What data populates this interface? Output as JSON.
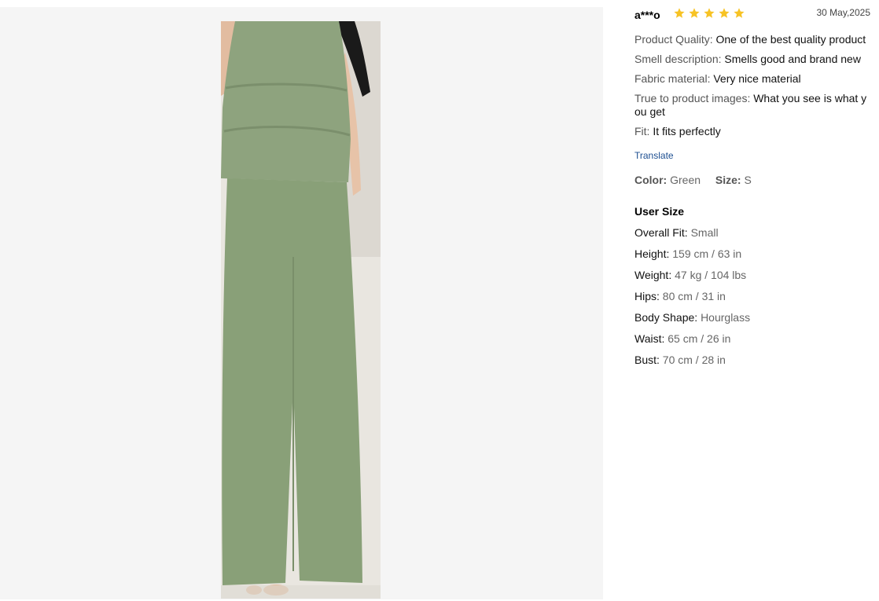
{
  "review": {
    "user": "a***o",
    "rating": 5,
    "date": "30 May,2025",
    "attributes": [
      {
        "key": "Product Quality:",
        "value": "One of the best quality product"
      },
      {
        "key": "Smell description:",
        "value": "Smells good and brand new"
      },
      {
        "key": "Fabric material:",
        "value": "Very nice material"
      },
      {
        "key": "True to product images:",
        "value": "What you see is what you get"
      },
      {
        "key": "Fit:",
        "value": "It fits perfectly"
      }
    ],
    "translate_label": "Translate",
    "color_label": "Color:",
    "color_value": "Green",
    "size_label": "Size:",
    "size_value": "S"
  },
  "user_size": {
    "title": "User Size",
    "rows": [
      {
        "key": "Overall Fit:",
        "value": "Small"
      },
      {
        "key": "Height:",
        "value": "159 cm / 63 in"
      },
      {
        "key": "Weight:",
        "value": "47 kg / 104 lbs"
      },
      {
        "key": "Hips:",
        "value": "80 cm / 31 in"
      },
      {
        "key": "Body Shape:",
        "value": "Hourglass"
      },
      {
        "key": "Waist:",
        "value": "65 cm / 26 in"
      },
      {
        "key": "Bust:",
        "value": "70 cm / 28 in"
      }
    ]
  },
  "colors": {
    "star": "#f7c325",
    "translate_link": "#1d4f91",
    "garment": "#8a9f7a",
    "gallery_bg": "#f5f5f5"
  }
}
